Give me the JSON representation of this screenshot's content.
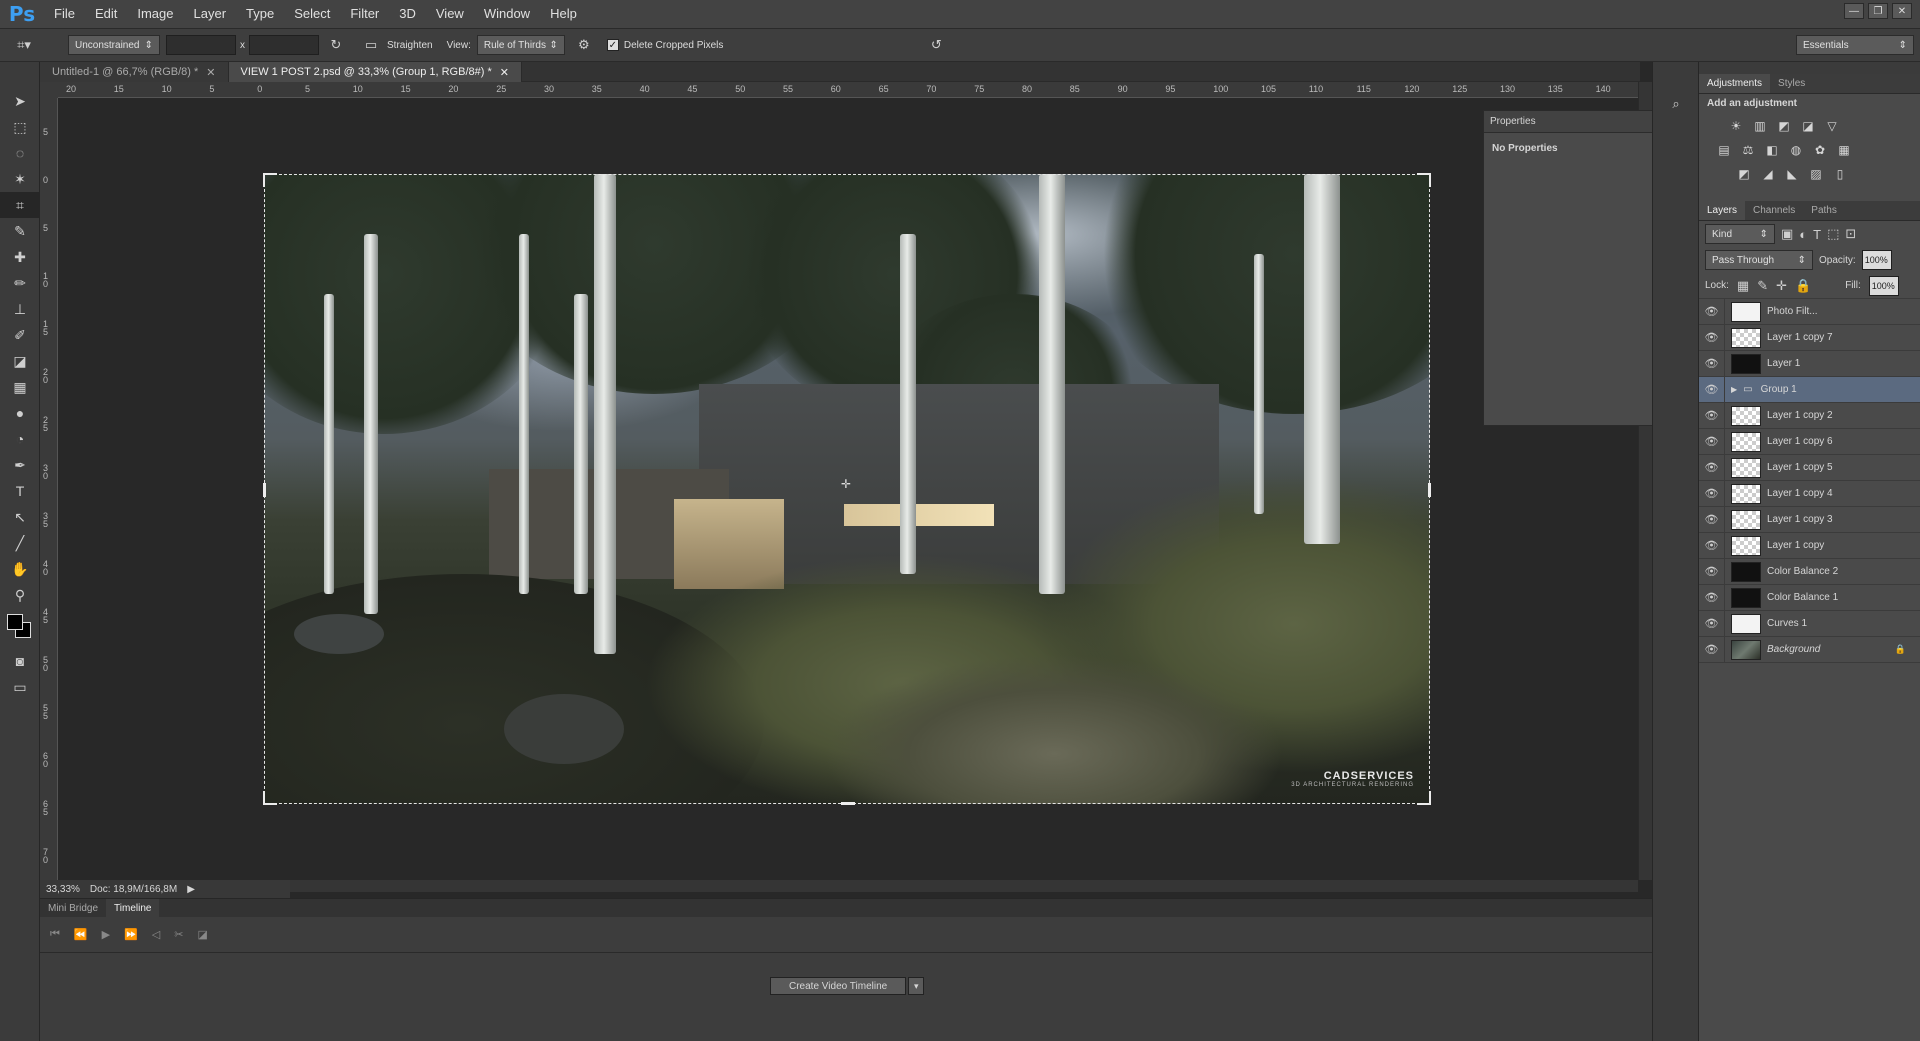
{
  "app": {
    "logo": "Ps"
  },
  "menu": [
    "File",
    "Edit",
    "Image",
    "Layer",
    "Type",
    "Select",
    "Filter",
    "3D",
    "View",
    "Window",
    "Help"
  ],
  "options_bar": {
    "ratio": "Unconstrained",
    "width_value": "",
    "x_label": "x",
    "height_value": "",
    "straighten": "Straighten",
    "view_label": "View:",
    "view_value": "Rule of Thirds",
    "delete_cropped": "Delete Cropped Pixels",
    "delete_cropped_checked": true,
    "workspace": "Essentials"
  },
  "doc_tabs": [
    {
      "label": "Untitled-1 @ 66,7% (RGB/8) *",
      "active": false
    },
    {
      "label": "VIEW 1 POST 2.psd @ 33,3% (Group 1, RGB/8#) *",
      "active": true
    }
  ],
  "ruler": {
    "h_ticks": [
      "20",
      "15",
      "10",
      "5",
      "0",
      "5",
      "10",
      "15",
      "20",
      "25",
      "30",
      "35",
      "40",
      "45",
      "50",
      "55",
      "60",
      "65",
      "70",
      "75",
      "80",
      "85",
      "90",
      "95",
      "100",
      "105",
      "110",
      "115",
      "120",
      "125",
      "130",
      "135",
      "140"
    ],
    "v_ticks": [
      "5",
      "0",
      "5",
      "1 0",
      "1 5",
      "2 0",
      "2 5",
      "3 0",
      "3 5",
      "4 0",
      "4 5",
      "5 0",
      "5 5",
      "6 0",
      "6 5",
      "7 0"
    ]
  },
  "canvas": {
    "watermark": "CADSERVICES",
    "watermark_sub": "3D ARCHITECTURAL RENDERING"
  },
  "properties": {
    "title": "Properties",
    "body": "No Properties"
  },
  "adjustments": {
    "tabs": [
      "Adjustments",
      "Styles"
    ],
    "heading": "Add an adjustment"
  },
  "layers_panel": {
    "tabs": [
      "Layers",
      "Channels",
      "Paths"
    ],
    "kind": "Kind",
    "blend_mode": "Pass Through",
    "opacity_label": "Opacity:",
    "opacity_value": "100%",
    "lock_label": "Lock:",
    "fill_label": "Fill:",
    "fill_value": "100%",
    "layers": [
      {
        "name": "Photo Filt...",
        "thumb": "white"
      },
      {
        "name": "Layer 1 copy 7",
        "thumb": "checker"
      },
      {
        "name": "Layer 1",
        "thumb": "black"
      },
      {
        "name": "Group 1",
        "thumb": "folder",
        "selected": true
      },
      {
        "name": "Layer 1 copy 2",
        "thumb": "checker"
      },
      {
        "name": "Layer 1 copy 6",
        "thumb": "checker"
      },
      {
        "name": "Layer 1 copy 5",
        "thumb": "checker"
      },
      {
        "name": "Layer 1 copy 4",
        "thumb": "checker"
      },
      {
        "name": "Layer 1 copy 3",
        "thumb": "checker"
      },
      {
        "name": "Layer 1 copy",
        "thumb": "checker"
      },
      {
        "name": "Color Balance 2",
        "thumb": "black"
      },
      {
        "name": "Color Balance 1",
        "thumb": "black"
      },
      {
        "name": "Curves 1",
        "thumb": "white"
      },
      {
        "name": "Background",
        "thumb": "photo"
      }
    ]
  },
  "status": {
    "zoom": "33,33%",
    "doc": "Doc: 18,9M/166,8M"
  },
  "timeline": {
    "tabs": [
      "Mini Bridge",
      "Timeline"
    ],
    "create_button": "Create Video Timeline"
  }
}
